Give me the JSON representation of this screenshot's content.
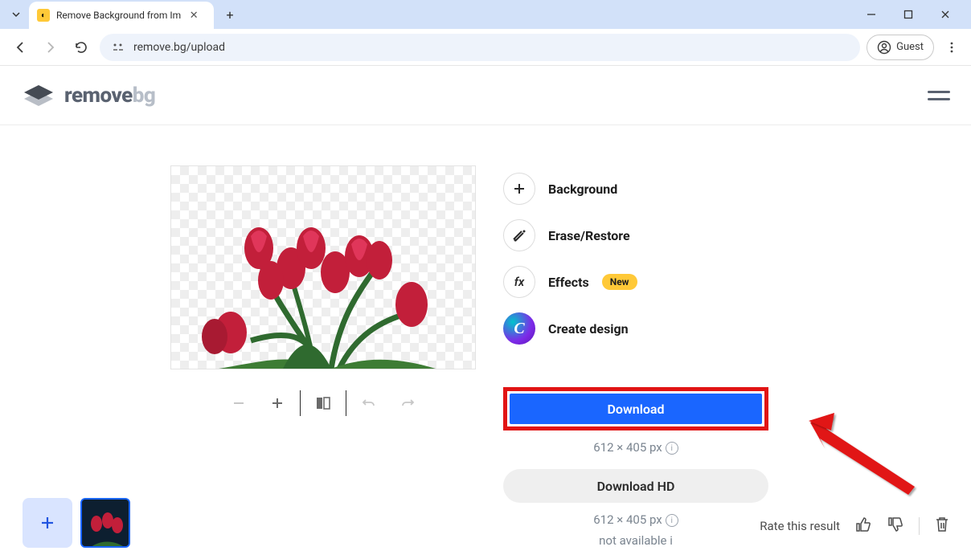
{
  "browser": {
    "tab_title": "Remove Background from Im",
    "url": "remove.bg/upload",
    "guest_label": "Guest"
  },
  "header": {
    "logo_strong": "remove",
    "logo_light": "bg"
  },
  "options": {
    "background": "Background",
    "erase_restore": "Erase/Restore",
    "effects": "Effects",
    "effects_badge": "New",
    "create_design": "Create design"
  },
  "actions": {
    "download": "Download",
    "download_dim": "612 × 405 px",
    "download_hd": "Download HD",
    "hd_dim": "612 × 405 px",
    "not_available": "not available"
  },
  "footer": {
    "rate_label": "Rate this result"
  }
}
